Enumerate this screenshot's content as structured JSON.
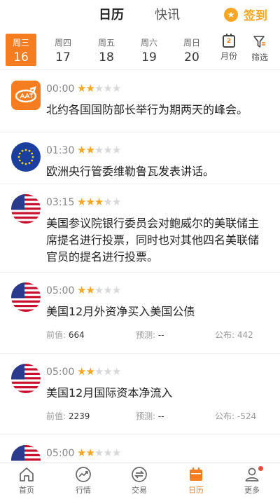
{
  "header": {
    "tab_calendar": "日历",
    "tab_news": "快讯",
    "signin_label": "签到"
  },
  "dates": [
    {
      "weekday": "周三",
      "day": "16",
      "active": true
    },
    {
      "weekday": "周四",
      "day": "17",
      "active": false
    },
    {
      "weekday": "周五",
      "day": "18",
      "active": false
    },
    {
      "weekday": "周六",
      "day": "19",
      "active": false
    },
    {
      "weekday": "周日",
      "day": "20",
      "active": false
    }
  ],
  "tools": {
    "month_icon_num": "2",
    "month_label": "月份",
    "filter_label": "筛选"
  },
  "events": [
    {
      "flag": "aat-logo",
      "time": "00:00",
      "stars": 2,
      "title": "北约各国国防部长举行为期两天的峰会。"
    },
    {
      "flag": "eu-flag",
      "time": "01:30",
      "stars": 2,
      "title": "欧洲央行管委维勒鲁瓦发表讲话。"
    },
    {
      "flag": "us-flag",
      "time": "03:15",
      "stars": 3,
      "title": "美国参议院银行委员会对鲍威尔的美联储主席提名进行投票，同时也对其他四名美联储官员的提名进行投票。"
    },
    {
      "flag": "us-flag",
      "time": "05:00",
      "stars": 2,
      "title": "美国12月外资净买入美国公债",
      "prev_label": "前值:",
      "prev": "664",
      "forecast_label": "预测:",
      "forecast": "--",
      "actual_label": "公布:",
      "actual": "442"
    },
    {
      "flag": "us-flag",
      "time": "05:00",
      "stars": 2,
      "title": "美国12月国际资本净流入",
      "prev_label": "前值:",
      "prev": "2239",
      "forecast_label": "预测:",
      "forecast": "--",
      "actual_label": "公布:",
      "actual": "-524"
    },
    {
      "flag": "us-flag",
      "time": "05:00",
      "stars": 2,
      "title": ""
    }
  ],
  "nav": [
    {
      "icon": "home-icon",
      "label": "首页"
    },
    {
      "icon": "market-icon",
      "label": "行情"
    },
    {
      "icon": "trade-icon",
      "label": "交易"
    },
    {
      "icon": "calendar-icon",
      "label": "日历"
    },
    {
      "icon": "user-icon",
      "label": "更多"
    }
  ],
  "colors": {
    "accent": "#f57c1f",
    "star": "#f6a623",
    "badge": "#f04a3a"
  }
}
